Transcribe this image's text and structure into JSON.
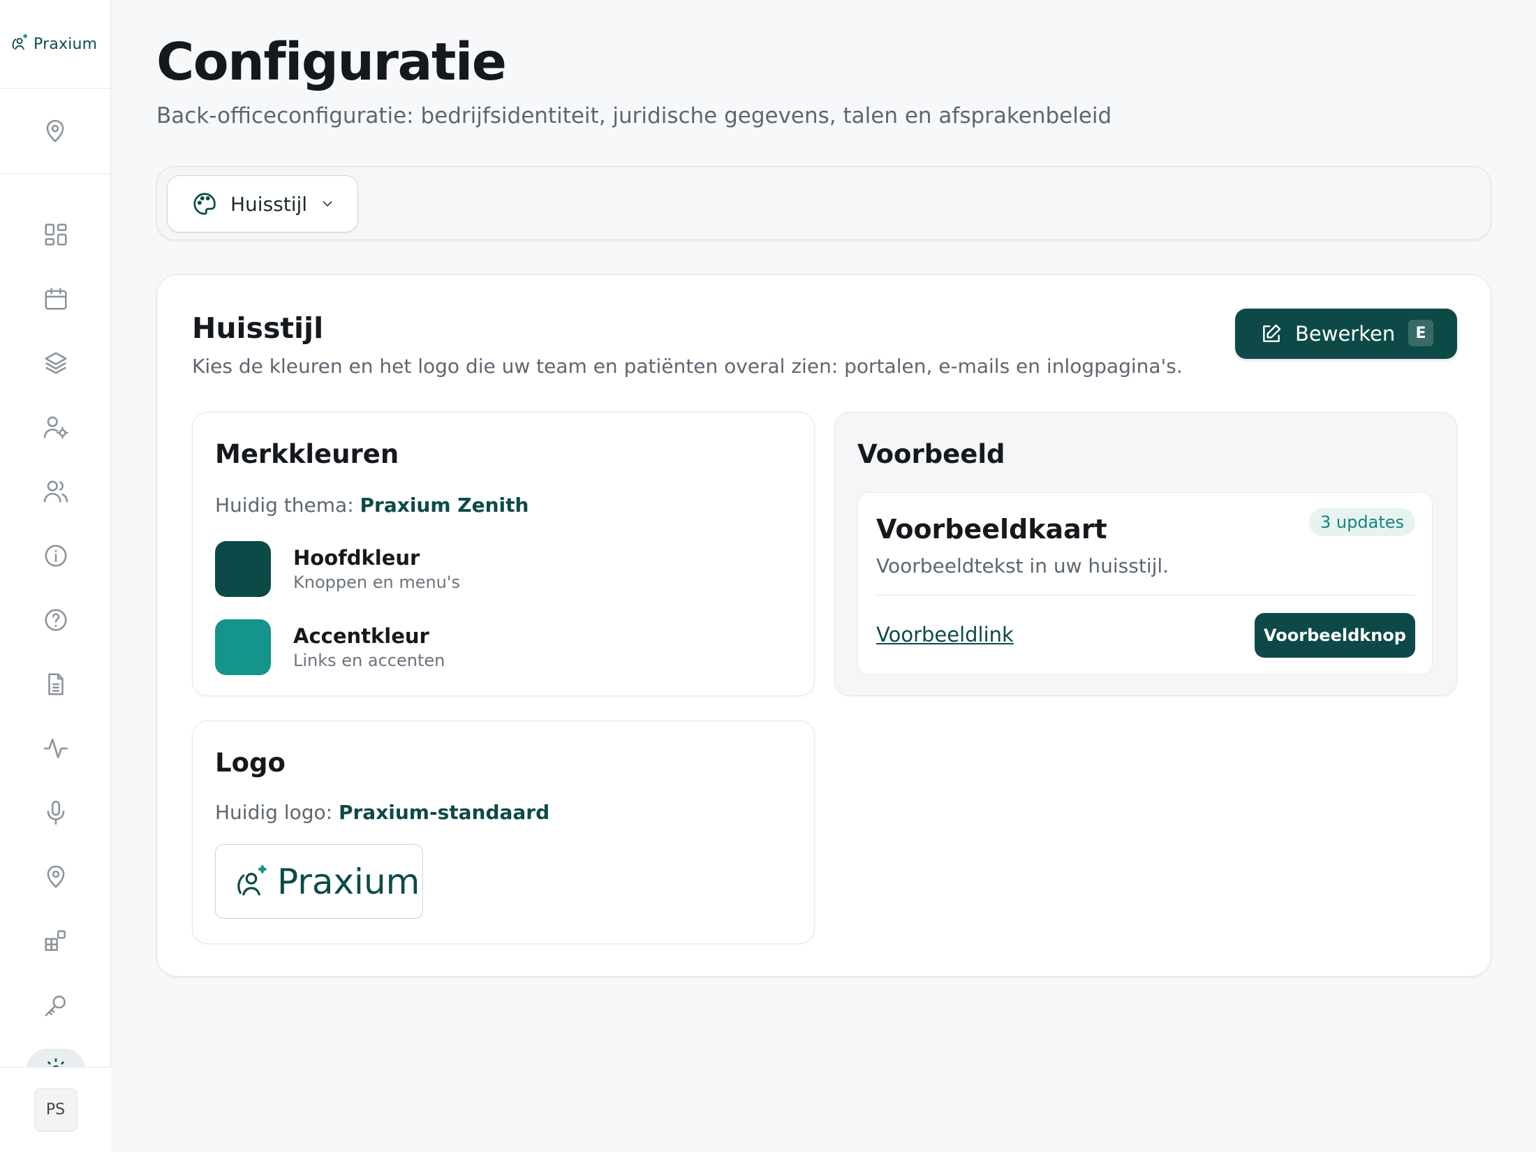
{
  "app": {
    "name": "Praxium"
  },
  "sidebar": {
    "items": [
      {
        "icon": "dashboard-icon"
      },
      {
        "icon": "calendar-icon"
      },
      {
        "icon": "layers-icon"
      },
      {
        "icon": "user-settings-icon"
      },
      {
        "icon": "users-icon"
      },
      {
        "icon": "info-icon"
      },
      {
        "icon": "help-icon"
      },
      {
        "icon": "document-icon"
      },
      {
        "icon": "activity-icon"
      },
      {
        "icon": "microphone-icon"
      },
      {
        "icon": "location-icon"
      },
      {
        "icon": "integrations-icon"
      },
      {
        "icon": "key-icon"
      },
      {
        "icon": "settings-icon",
        "active": true
      }
    ],
    "user_initials": "PS"
  },
  "header": {
    "title": "Configuratie",
    "subtitle": "Back-officeconfiguratie: bedrijfsidentiteit, juridische gegevens, talen en afsprakenbeleid"
  },
  "section_select": {
    "selected": "Huisstijl",
    "icon": "palette-icon"
  },
  "card": {
    "title": "Huisstijl",
    "description": "Kies de kleuren en het logo die uw team en patiënten overal zien: portalen, e-mails en inlogpagina's.",
    "edit_label": "Bewerken",
    "edit_shortcut": "E"
  },
  "brand_colors": {
    "title": "Merkkleuren",
    "theme_label": "Huidig thema:",
    "theme_value": "Praxium Zenith",
    "colors": [
      {
        "name": "Hoofdkleur",
        "desc": "Knoppen en menu's",
        "hex": "#0b4a47"
      },
      {
        "name": "Accentkleur",
        "desc": "Links en accenten",
        "hex": "#14948a"
      }
    ]
  },
  "logo": {
    "title": "Logo",
    "current_label": "Huidig logo:",
    "current_value": "Praxium-standaard",
    "preview_text": "Praxium"
  },
  "preview": {
    "title": "Voorbeeld",
    "card_title": "Voorbeeldkaart",
    "card_text": "Voorbeeldtekst in uw huisstijl.",
    "badge": "3 updates",
    "link": "Voorbeeldlink",
    "button": "Voorbeeldknop"
  }
}
